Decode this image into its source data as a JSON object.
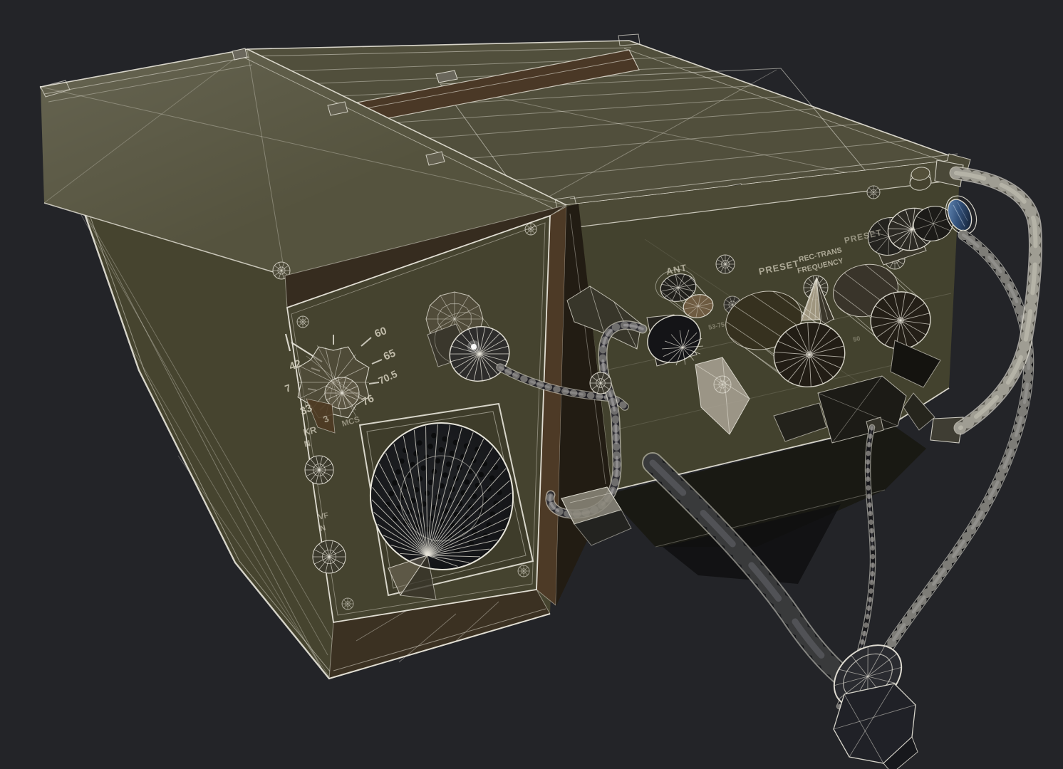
{
  "meta": {
    "description": "Wireframe 3D render of a military field radio set with handset cable and carry handle"
  },
  "scene": {
    "background": "#232428",
    "wireframe": "#e8e5da",
    "olive_top": "#55533e",
    "olive_body": "#46442f",
    "olive_panel": "#43422e",
    "brown_recess": "#4d3a26",
    "dark_metal": "#1a1a1c",
    "glass_blue": "#33527c"
  },
  "speaker_unit": {
    "dial": {
      "numbers": [
        "60",
        "65",
        "70.5",
        "76",
        "42",
        "7",
        "33",
        "3"
      ],
      "band_label": "MCS"
    },
    "switch_labels": {
      "spkr_top": "KR",
      "spkr_bottom": "N",
      "aux_top": "VF",
      "aux_bottom": "N"
    }
  },
  "control_panel": {
    "labels": {
      "ant": "ANT",
      "preset_left": "PRESET",
      "rec_trans_line1": "REC-TRANS",
      "rec_trans_line2": "FREQUENCY",
      "preset_right": "PRESET",
      "freq_range_small": "53-75",
      "freq_range_right": "50"
    }
  }
}
